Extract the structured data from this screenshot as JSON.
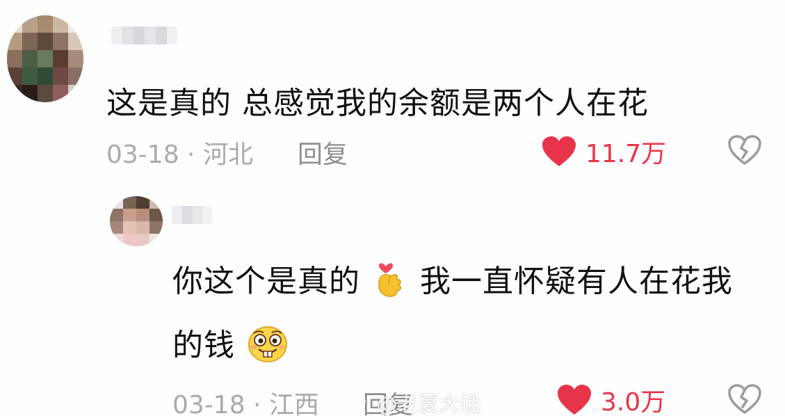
{
  "comments": [
    {
      "text": "这是真的 总感觉我的余额是两个人在花",
      "date_location": "03-18 · 河北",
      "reply_label": "回复",
      "likes": "11.7万"
    },
    {
      "text_line1": "你这个是真的",
      "text_line1_b": "我一直怀疑有人在花我",
      "text_line2": "的钱",
      "date_location": "03-18 · 江西",
      "reply_label": "回复",
      "likes": "3.0万"
    }
  ],
  "watermark": "@老夏大话",
  "icons": {
    "like": "heart-icon",
    "dislike": "broken-heart-icon",
    "emoji1": "finger-heart-emoji",
    "emoji2": "buck-teeth-smile-emoji"
  },
  "colors": {
    "like": "#e8344a",
    "meta": "#a9a9ae",
    "text": "#111111"
  }
}
